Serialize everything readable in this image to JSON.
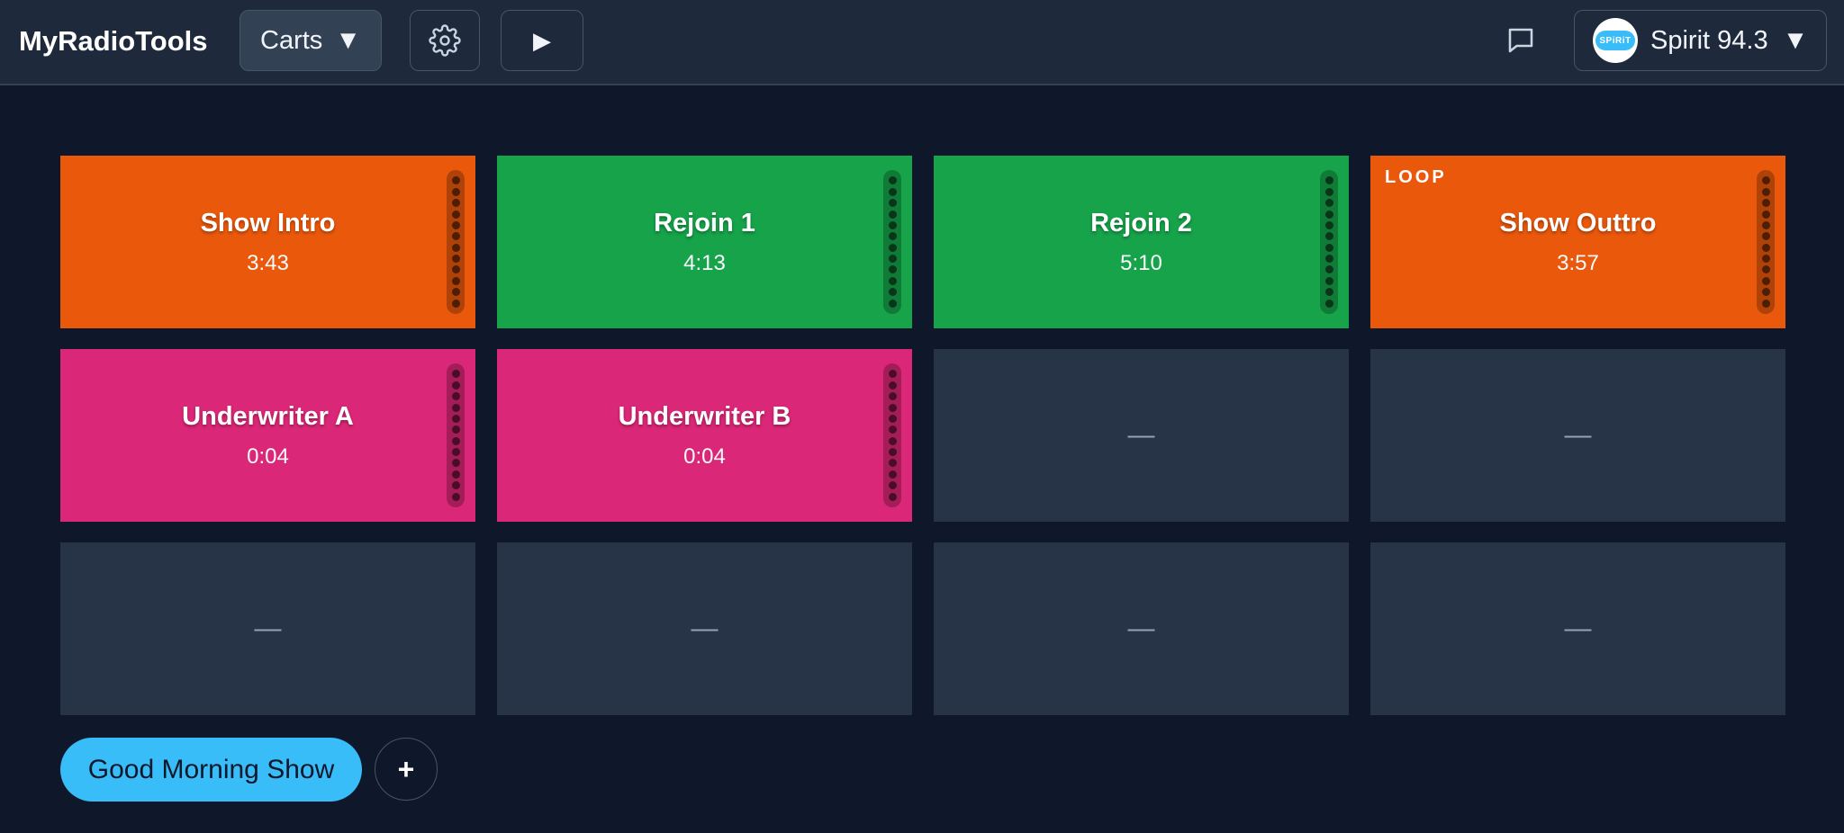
{
  "header": {
    "brand": "MyRadioTools",
    "section_label": "Carts",
    "section_caret": "▼",
    "settings_icon": "gear-icon",
    "play_symbol": "▶",
    "chat_icon": "chat-icon",
    "station": {
      "name": "Spirit 94.3",
      "logo_text": "SPiRiT",
      "caret": "▼"
    }
  },
  "colors": {
    "orange": "#ea580c",
    "green": "#16a34a",
    "pink": "#db2777",
    "empty": "#273346",
    "accent": "#38bdf8"
  },
  "carts": [
    {
      "name": "Show Intro",
      "duration": "3:43",
      "color": "#ea580c",
      "loop": ""
    },
    {
      "name": "Rejoin 1",
      "duration": "4:13",
      "color": "#16a34a",
      "loop": ""
    },
    {
      "name": "Rejoin 2",
      "duration": "5:10",
      "color": "#16a34a",
      "loop": ""
    },
    {
      "name": "Show Outtro",
      "duration": "3:57",
      "color": "#ea580c",
      "loop": "LOOP"
    },
    {
      "name": "Underwriter A",
      "duration": "0:04",
      "color": "#db2777",
      "loop": ""
    },
    {
      "name": "Underwriter B",
      "duration": "0:04",
      "color": "#db2777",
      "loop": ""
    },
    {
      "empty_label": "—"
    },
    {
      "empty_label": "—"
    },
    {
      "empty_label": "—"
    },
    {
      "empty_label": "—"
    },
    {
      "empty_label": "—"
    },
    {
      "empty_label": "—"
    }
  ],
  "footer": {
    "active_set": "Good Morning Show",
    "add_symbol": "+"
  }
}
